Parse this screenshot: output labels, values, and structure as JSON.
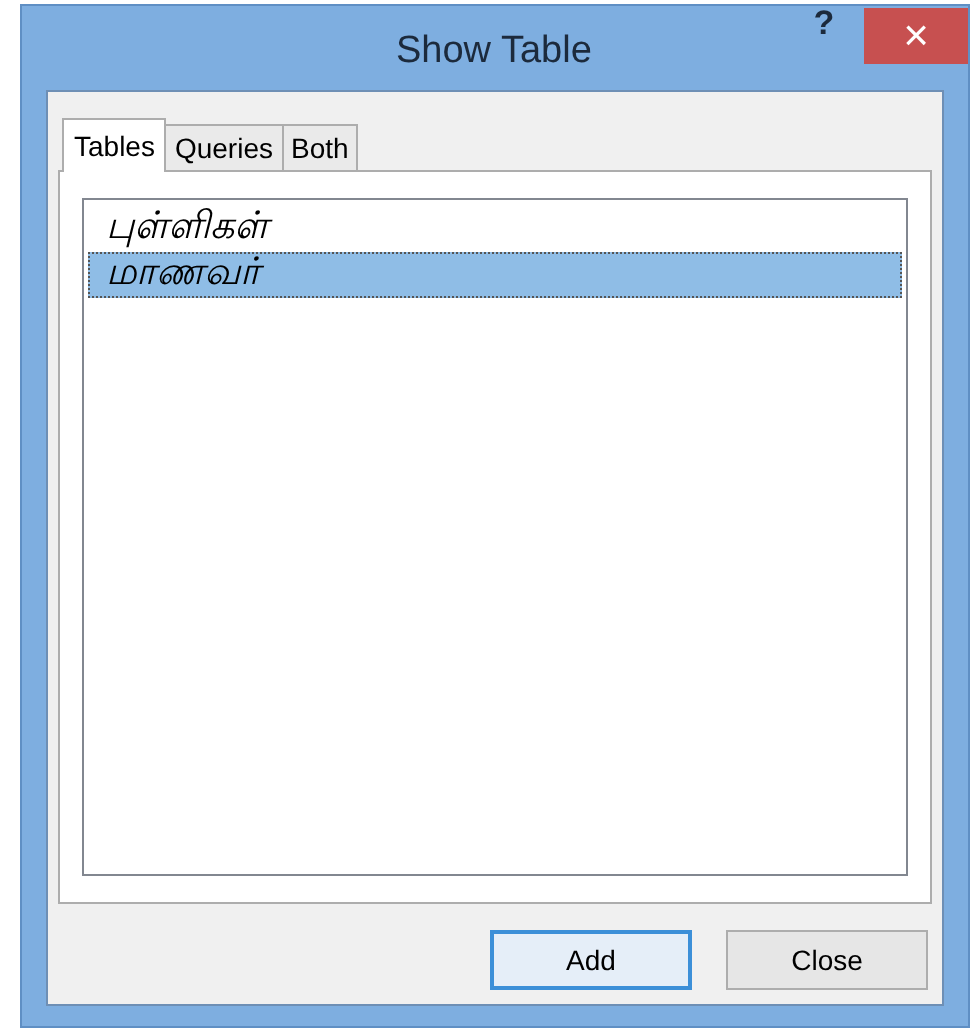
{
  "window": {
    "title": "Show Table",
    "help": "?",
    "close": "×"
  },
  "tabs": [
    {
      "label": "Tables",
      "selected": true
    },
    {
      "label": "Queries",
      "selected": false
    },
    {
      "label": "Both",
      "selected": false
    }
  ],
  "list": [
    {
      "label": "புள்ளிகள்",
      "selected": false
    },
    {
      "label": "மாணவர்",
      "selected": true
    }
  ],
  "buttons": [
    {
      "label": "Add",
      "default": true
    },
    {
      "label": "Close",
      "default": false
    }
  ]
}
